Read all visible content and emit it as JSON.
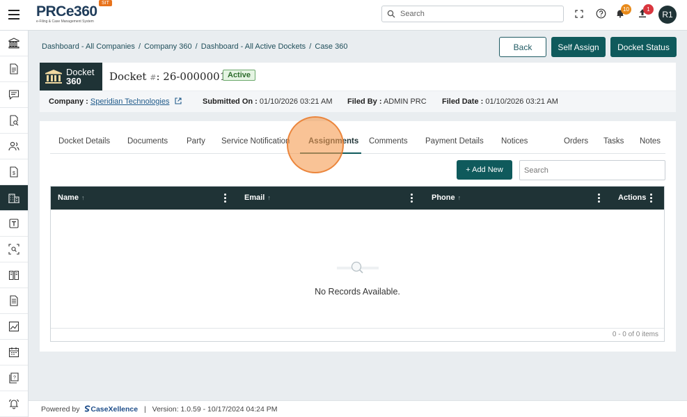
{
  "app": {
    "logo_text": "PRCe360",
    "logo_tagline": "e-Filing & Case Management System",
    "env_badge": "SIT",
    "search_placeholder": "Search",
    "notifications_count": "10",
    "uploads_count": "1",
    "avatar_initials": "R1",
    "colors": {
      "primary": "#1f3336",
      "accent": "#0f5a5c",
      "notif_badge": "#e88a1a",
      "upload_badge": "#d9363e"
    }
  },
  "sidebar": {
    "items": [
      {
        "icon": "bank-icon"
      },
      {
        "icon": "document-icon"
      },
      {
        "icon": "chat-icon"
      },
      {
        "icon": "document-search-icon"
      },
      {
        "icon": "users-icon"
      },
      {
        "icon": "dollar-document-icon"
      },
      {
        "icon": "building-icon",
        "active": true
      },
      {
        "icon": "template-icon"
      },
      {
        "icon": "scan-search-icon"
      },
      {
        "icon": "book-icon"
      },
      {
        "icon": "file-text-icon"
      },
      {
        "icon": "chart-icon"
      },
      {
        "icon": "calendar-icon"
      },
      {
        "icon": "help-document-icon"
      },
      {
        "icon": "bell-ring-icon"
      }
    ]
  },
  "breadcrumb": {
    "items": [
      "Dashboard - All Companies",
      "Company 360",
      "Dashboard - All Active Dockets",
      "Case 360"
    ],
    "separator": "/"
  },
  "actions": {
    "back": "Back",
    "self_assign": "Self Assign",
    "docket_status": "Docket Status"
  },
  "docket": {
    "badge_line1": "Docket",
    "badge_line2": "360",
    "title_prefix": "Docket",
    "title_hash": "#",
    "title_number": ": 26-0000001",
    "status": "Active",
    "company_label": "Company :",
    "company_value": "Speridian Technologies",
    "submitted_label": "Submitted On :",
    "submitted_value": "01/10/2026 03:21 AM",
    "filed_by_label": "Filed By :",
    "filed_by_value": "ADMIN PRC",
    "filed_date_label": "Filed Date :",
    "filed_date_value": "01/10/2026 03:21 AM"
  },
  "tabs": [
    "Docket Details",
    "Documents",
    "Party",
    "Service Notification",
    "Assignments",
    "Comments",
    "Payment Details",
    "Notices",
    "Orders",
    "Tasks",
    "Notes"
  ],
  "active_tab": "Assignments",
  "grid": {
    "add_button": "+ Add New",
    "search_placeholder": "Search",
    "columns": [
      "Name",
      "Email",
      "Phone",
      "Actions"
    ],
    "sort_arrow": "↑",
    "empty_text": "No Records Available.",
    "pager_text": "0 - 0 of 0 items"
  },
  "footer": {
    "powered_by": "Powered by",
    "brand": "CaseXellence",
    "separator": "|",
    "version": "Version: 1.0.59 - 10/17/2024 04:24 PM"
  }
}
